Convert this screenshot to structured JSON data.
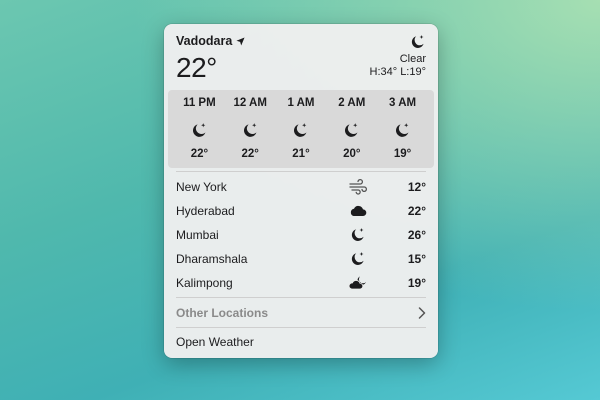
{
  "current": {
    "city": "Vadodara",
    "temperature": "22°",
    "condition": "Clear",
    "high_low": "H:34° L:19°",
    "icon": "moon-stars-icon"
  },
  "hourly": [
    {
      "time": "11 PM",
      "temp": "22°",
      "icon": "moon-stars-icon"
    },
    {
      "time": "12 AM",
      "temp": "22°",
      "icon": "moon-stars-icon"
    },
    {
      "time": "1 AM",
      "temp": "21°",
      "icon": "moon-stars-icon"
    },
    {
      "time": "2 AM",
      "temp": "20°",
      "icon": "moon-stars-icon"
    },
    {
      "time": "3 AM",
      "temp": "19°",
      "icon": "moon-stars-icon"
    }
  ],
  "locations": [
    {
      "name": "New York",
      "temp": "12°",
      "icon": "wind-icon"
    },
    {
      "name": "Hyderabad",
      "temp": "22°",
      "icon": "cloud-icon"
    },
    {
      "name": "Mumbai",
      "temp": "26°",
      "icon": "moon-stars-icon"
    },
    {
      "name": "Dharamshala",
      "temp": "15°",
      "icon": "moon-stars-icon"
    },
    {
      "name": "Kalimpong",
      "temp": "19°",
      "icon": "moon-cloud-icon"
    }
  ],
  "other_locations_label": "Other Locations",
  "open_weather_label": "Open Weather"
}
